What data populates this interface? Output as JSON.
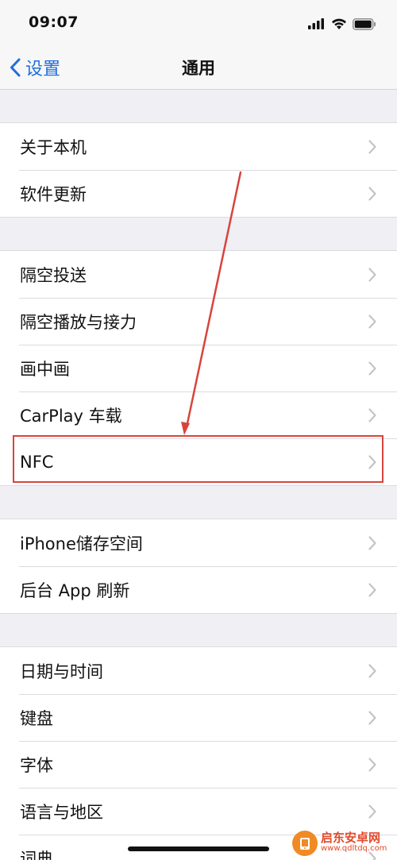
{
  "status_bar": {
    "time": "09:07"
  },
  "nav": {
    "back_label": "设置",
    "title": "通用"
  },
  "groups": [
    {
      "items": [
        {
          "label": "关于本机"
        },
        {
          "label": "软件更新"
        }
      ]
    },
    {
      "items": [
        {
          "label": "隔空投送"
        },
        {
          "label": "隔空播放与接力"
        },
        {
          "label": "画中画"
        },
        {
          "label": "CarPlay 车载"
        },
        {
          "label": "NFC"
        }
      ]
    },
    {
      "items": [
        {
          "label": "iPhone储存空间"
        },
        {
          "label": "后台 App 刷新"
        }
      ]
    },
    {
      "items": [
        {
          "label": "日期与时间"
        },
        {
          "label": "键盘"
        },
        {
          "label": "字体"
        },
        {
          "label": "语言与地区"
        },
        {
          "label": "词典"
        }
      ]
    }
  ],
  "annotation": {
    "color": "#d8443c"
  },
  "watermark": {
    "title": "启东安卓网",
    "url": "www.qdltdq.com"
  },
  "colors": {
    "accent": "#1f6fd9",
    "background": "#efeff4",
    "chevron": "#c4c4c7"
  }
}
